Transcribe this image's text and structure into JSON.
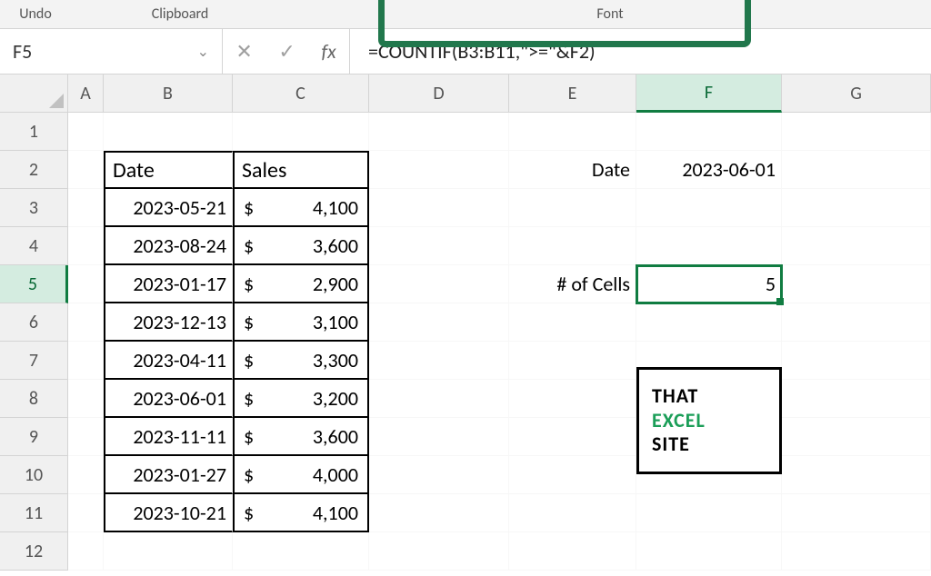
{
  "ribbon": {
    "undo": "Undo",
    "clipboard": "Clipboard",
    "font": "Font"
  },
  "nameBox": "F5",
  "formula": "=COUNTIF(B3:B11,\">=\"&F2)",
  "columns": [
    "A",
    "B",
    "C",
    "D",
    "E",
    "F",
    "G"
  ],
  "rows": [
    "1",
    "2",
    "3",
    "4",
    "5",
    "6",
    "7",
    "8",
    "9",
    "10",
    "11",
    "12"
  ],
  "tableHeaders": {
    "date": "Date",
    "sales": "Sales"
  },
  "table": [
    {
      "date": "2023-05-21",
      "sales": "4,100"
    },
    {
      "date": "2023-08-24",
      "sales": "3,600"
    },
    {
      "date": "2023-01-17",
      "sales": "2,900"
    },
    {
      "date": "2023-12-13",
      "sales": "3,100"
    },
    {
      "date": "2023-04-11",
      "sales": "3,300"
    },
    {
      "date": "2023-06-01",
      "sales": "3,200"
    },
    {
      "date": "2023-11-11",
      "sales": "3,600"
    },
    {
      "date": "2023-01-27",
      "sales": "4,000"
    },
    {
      "date": "2023-10-21",
      "sales": "4,100"
    }
  ],
  "currencySymbol": "$",
  "labels": {
    "dateLabel": "Date",
    "dateValue": "2023-06-01",
    "cellsLabel": "# of Cells",
    "cellsValue": "5"
  },
  "logo": {
    "line1": "THAT",
    "line2": "EXCEL",
    "line3": "SITE"
  },
  "chart_data": {
    "type": "table",
    "title": "COUNTIF greater-than-or-equal example",
    "headers": [
      "Date",
      "Sales"
    ],
    "rows": [
      [
        "2023-05-21",
        4100
      ],
      [
        "2023-08-24",
        3600
      ],
      [
        "2023-01-17",
        2900
      ],
      [
        "2023-12-13",
        3100
      ],
      [
        "2023-04-11",
        3300
      ],
      [
        "2023-06-01",
        3200
      ],
      [
        "2023-11-11",
        3600
      ],
      [
        "2023-01-27",
        4000
      ],
      [
        "2023-10-21",
        4100
      ]
    ],
    "criteria": {
      "label": "Date",
      "value": "2023-06-01"
    },
    "result": {
      "label": "# of Cells",
      "value": 5
    },
    "formula": "=COUNTIF(B3:B11,\">=\"&F2)"
  }
}
